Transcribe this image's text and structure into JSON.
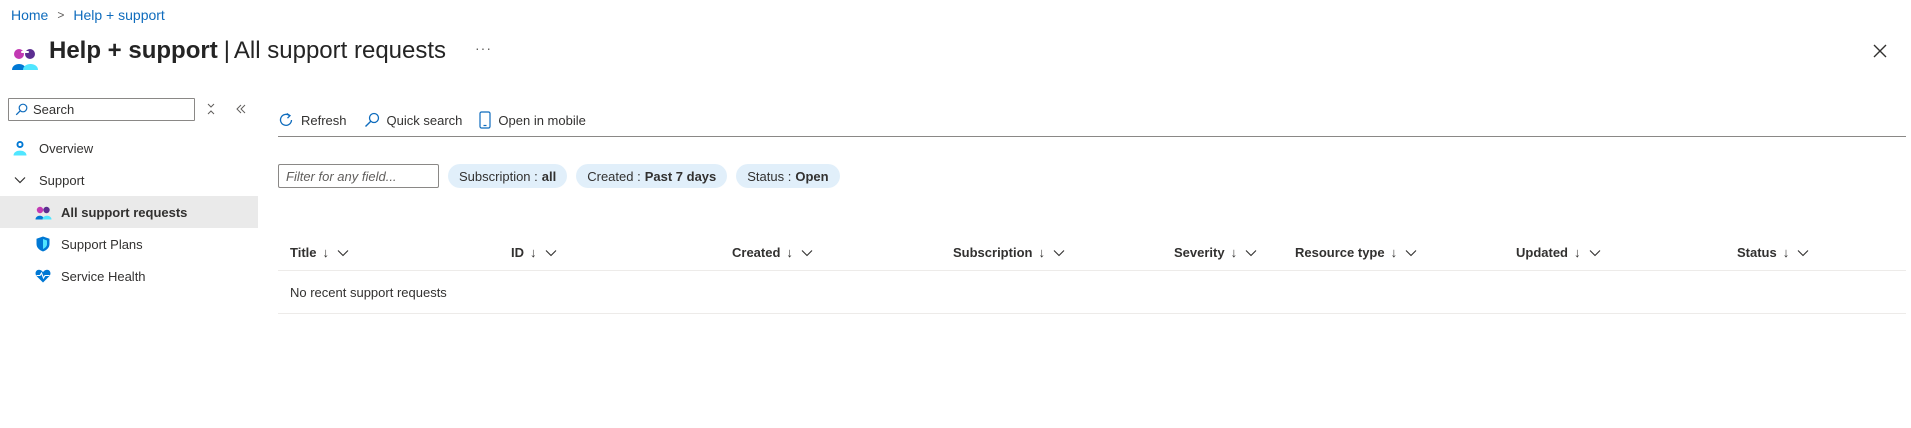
{
  "breadcrumb": {
    "home": "Home",
    "current": "Help + support"
  },
  "header": {
    "title_bold": "Help + support",
    "title_separator": "|",
    "title_sub": "All support requests",
    "more": "···"
  },
  "sidebar": {
    "search_placeholder": "Search",
    "items": [
      {
        "label": "Overview",
        "icon": "overview-icon"
      },
      {
        "label": "Support",
        "icon": "chevron-down-icon"
      },
      {
        "label": "All support requests",
        "icon": "support-requests-icon",
        "active": true
      },
      {
        "label": "Support Plans",
        "icon": "shield-icon"
      },
      {
        "label": "Service Health",
        "icon": "heart-pulse-icon"
      }
    ]
  },
  "toolbar": {
    "refresh": "Refresh",
    "quick_search": "Quick search",
    "open_in_mobile": "Open in mobile"
  },
  "filters": {
    "placeholder": "Filter for any field...",
    "pills": [
      {
        "label": "Subscription :",
        "value": "all"
      },
      {
        "label": "Created :",
        "value": "Past 7 days"
      },
      {
        "label": "Status :",
        "value": "Open"
      }
    ]
  },
  "table": {
    "sort_arrow": "↓",
    "columns": [
      "Title",
      "ID",
      "Created",
      "Subscription",
      "Severity",
      "Resource type",
      "Updated",
      "Status"
    ],
    "empty_message": "No recent support requests"
  },
  "colors": {
    "link": "#0f6cbd",
    "pill_bg": "#e1effa",
    "active_nav_bg": "#eaeaea"
  }
}
